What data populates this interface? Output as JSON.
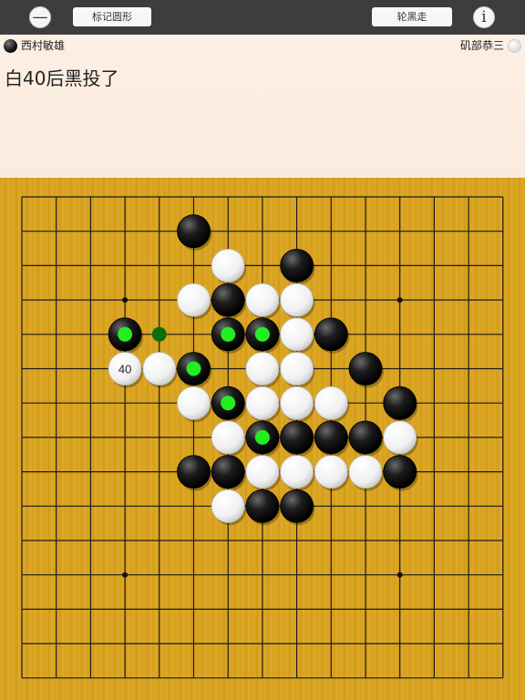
{
  "toolbar": {
    "minus_glyph": "—",
    "mark_label": "标记圆形",
    "turn_label": "轮黑走",
    "info_glyph": "i"
  },
  "players": {
    "black_name": "西村敏雄",
    "white_name": "矶部恭三"
  },
  "status_message": "白40后黑投了",
  "colors": {
    "toolbar_bg": "#3d3d3d",
    "panel_bg": "#fcefe3",
    "board_wood": "#d8a11b",
    "marker_green": "#22ee22",
    "last_move_dot": "#0a6e0a"
  },
  "board": {
    "size": 15,
    "star_points": [
      [
        3,
        3
      ],
      [
        11,
        3
      ],
      [
        3,
        11
      ],
      [
        11,
        11
      ]
    ],
    "stones": [
      {
        "col": 5,
        "row": 1,
        "color": "black"
      },
      {
        "col": 6,
        "row": 2,
        "color": "white"
      },
      {
        "col": 8,
        "row": 2,
        "color": "black"
      },
      {
        "col": 5,
        "row": 3,
        "color": "white"
      },
      {
        "col": 6,
        "row": 3,
        "color": "black"
      },
      {
        "col": 7,
        "row": 3,
        "color": "white"
      },
      {
        "col": 8,
        "row": 3,
        "color": "white"
      },
      {
        "col": 3,
        "row": 4,
        "color": "black",
        "marked": true
      },
      {
        "col": 6,
        "row": 4,
        "color": "black",
        "marked": true
      },
      {
        "col": 7,
        "row": 4,
        "color": "black",
        "marked": true
      },
      {
        "col": 8,
        "row": 4,
        "color": "white"
      },
      {
        "col": 9,
        "row": 4,
        "color": "black"
      },
      {
        "col": 3,
        "row": 5,
        "color": "white",
        "label": "40"
      },
      {
        "col": 4,
        "row": 5,
        "color": "white"
      },
      {
        "col": 5,
        "row": 5,
        "color": "black",
        "marked": true
      },
      {
        "col": 7,
        "row": 5,
        "color": "white"
      },
      {
        "col": 8,
        "row": 5,
        "color": "white"
      },
      {
        "col": 10,
        "row": 5,
        "color": "black"
      },
      {
        "col": 5,
        "row": 6,
        "color": "white"
      },
      {
        "col": 6,
        "row": 6,
        "color": "black",
        "marked": true
      },
      {
        "col": 7,
        "row": 6,
        "color": "white"
      },
      {
        "col": 8,
        "row": 6,
        "color": "white"
      },
      {
        "col": 9,
        "row": 6,
        "color": "white"
      },
      {
        "col": 11,
        "row": 6,
        "color": "black"
      },
      {
        "col": 6,
        "row": 7,
        "color": "white"
      },
      {
        "col": 7,
        "row": 7,
        "color": "black",
        "marked": true
      },
      {
        "col": 8,
        "row": 7,
        "color": "black"
      },
      {
        "col": 9,
        "row": 7,
        "color": "black"
      },
      {
        "col": 10,
        "row": 7,
        "color": "black"
      },
      {
        "col": 11,
        "row": 7,
        "color": "white"
      },
      {
        "col": 5,
        "row": 8,
        "color": "black"
      },
      {
        "col": 6,
        "row": 8,
        "color": "black"
      },
      {
        "col": 7,
        "row": 8,
        "color": "white"
      },
      {
        "col": 8,
        "row": 8,
        "color": "white"
      },
      {
        "col": 9,
        "row": 8,
        "color": "white"
      },
      {
        "col": 10,
        "row": 8,
        "color": "white"
      },
      {
        "col": 11,
        "row": 8,
        "color": "black"
      },
      {
        "col": 6,
        "row": 9,
        "color": "white"
      },
      {
        "col": 7,
        "row": 9,
        "color": "black"
      },
      {
        "col": 8,
        "row": 9,
        "color": "black"
      }
    ],
    "empty_markers": [
      {
        "col": 4,
        "row": 4
      }
    ]
  }
}
